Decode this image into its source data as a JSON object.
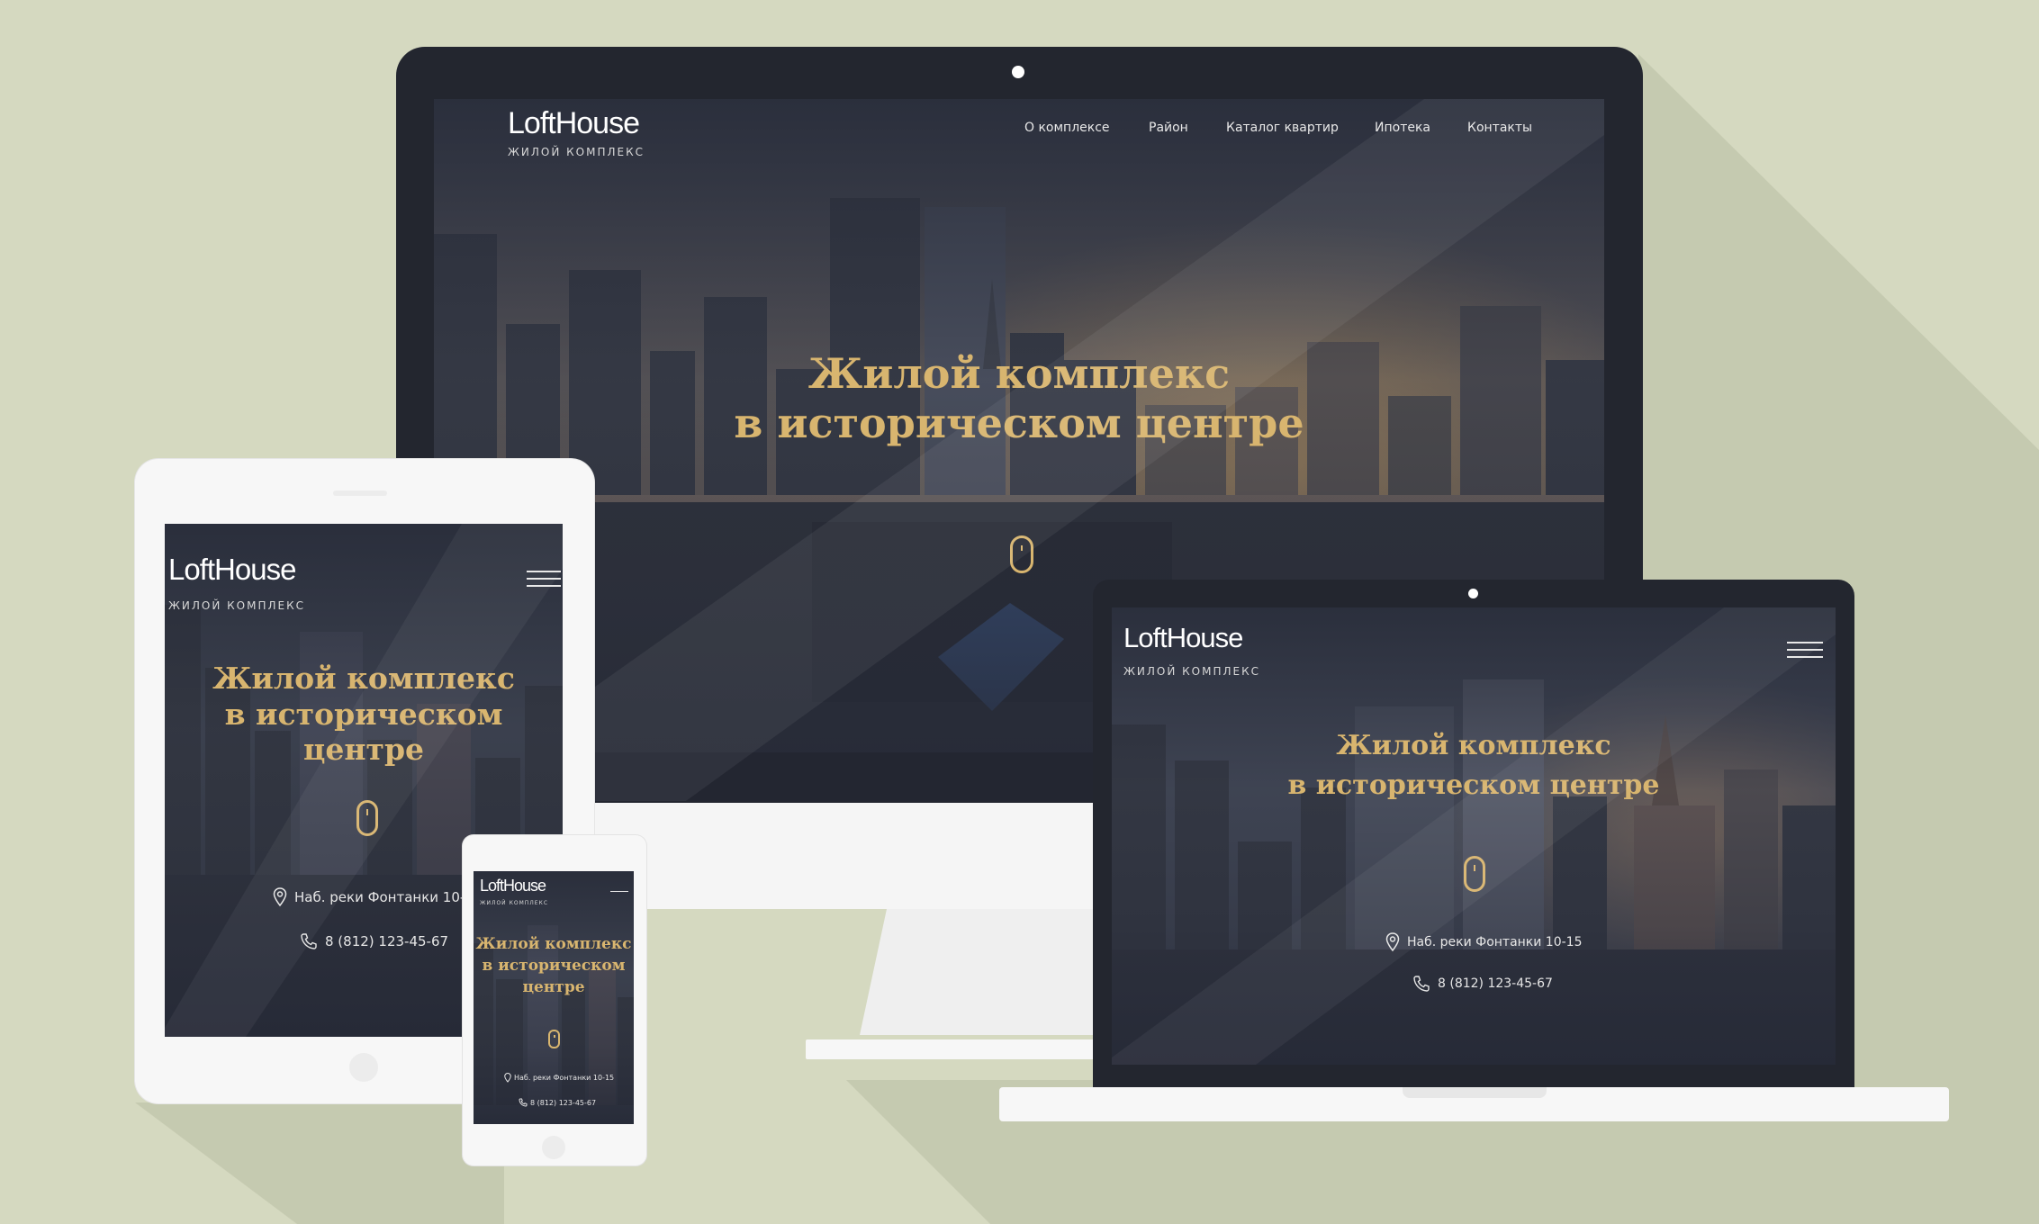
{
  "brand": {
    "name": "LoftHouse",
    "tagline": "жилой комплекс"
  },
  "nav": {
    "items": [
      "О комплексе",
      "Район",
      "Каталог квартир",
      "Ипотека",
      "Контакты"
    ]
  },
  "hero": {
    "line1": "Жилой комплекс",
    "line2": "в историческом центре",
    "mobile_line1": "Жилой комплекс",
    "mobile_line2": "в историческом",
    "mobile_line3": "центре"
  },
  "contacts": {
    "address": "Наб. реки Фонтанки 10-15",
    "phone": "8 (812) 123-45-67"
  },
  "icons": {
    "location": "location-pin-icon",
    "phone": "phone-icon",
    "menu": "hamburger-menu-icon",
    "scroll": "scroll-mouse-icon"
  },
  "colors": {
    "background": "#d5d9c0",
    "accent_gold": "#d8b56f",
    "screen_dark": "#252936",
    "device_frame_dark": "#2c2f3b",
    "device_frame_white": "#f7f7f7"
  }
}
